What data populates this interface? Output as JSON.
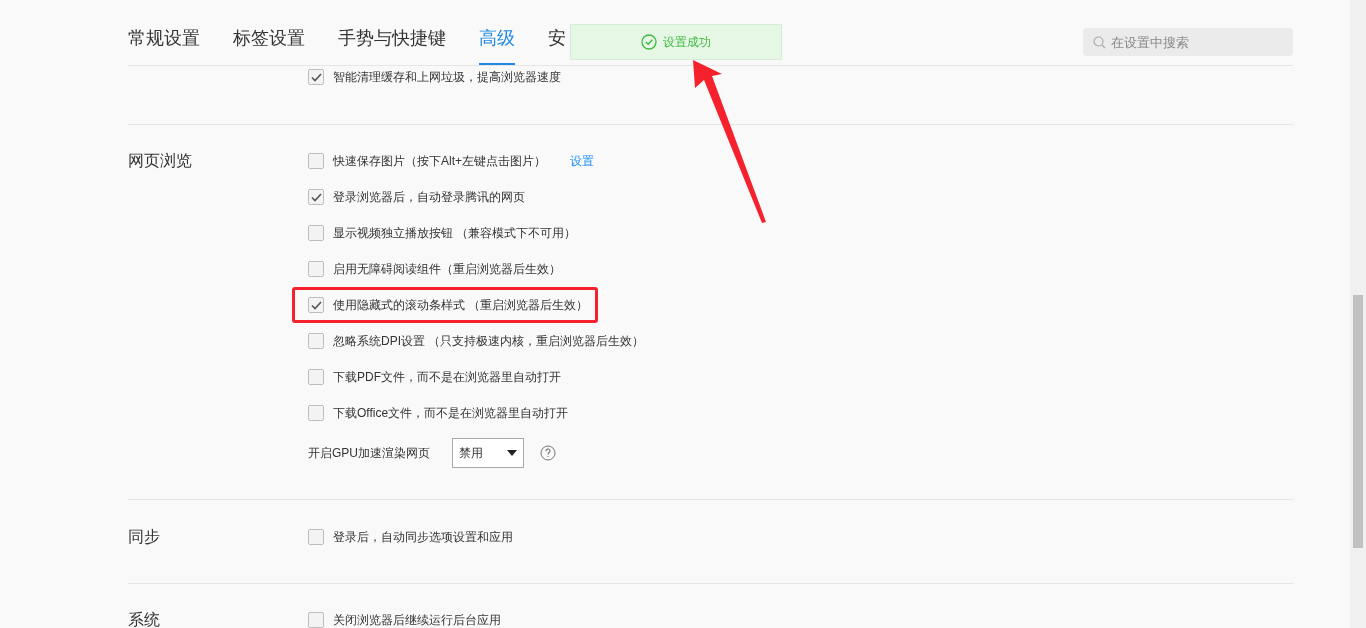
{
  "tabs": [
    {
      "label": "常规设置",
      "selected": false
    },
    {
      "label": "标签设置",
      "selected": false
    },
    {
      "label": "手势与快捷键",
      "selected": false
    },
    {
      "label": "高级",
      "selected": true
    },
    {
      "label": "安",
      "selected": false
    }
  ],
  "toast": {
    "text": "设置成功"
  },
  "search": {
    "placeholder": "在设置中搜索"
  },
  "sections": [
    {
      "options": [
        {
          "kind": "checkbox",
          "label": "智能清理缓存和上网垃圾，提高浏览器速度",
          "checked": true,
          "highlighted": false
        }
      ]
    },
    {
      "title": "网页浏览",
      "options": [
        {
          "kind": "checkbox",
          "label": "快速保存图片（按下Alt+左键点击图片）",
          "checked": false,
          "highlighted": false,
          "link": "设置"
        },
        {
          "kind": "checkbox",
          "label": "登录浏览器后，自动登录腾讯的网页",
          "checked": true,
          "highlighted": false
        },
        {
          "kind": "checkbox",
          "label": "显示视频独立播放按钮 （兼容模式下不可用）",
          "checked": false,
          "highlighted": false
        },
        {
          "kind": "checkbox",
          "label": "启用无障碍阅读组件（重启浏览器后生效）",
          "checked": false,
          "highlighted": false
        },
        {
          "kind": "checkbox",
          "label": "使用隐藏式的滚动条样式 （重启浏览器后生效）",
          "checked": true,
          "highlighted": true
        },
        {
          "kind": "checkbox",
          "label": "忽略系统DPI设置 （只支持极速内核，重启浏览器后生效）",
          "checked": false,
          "highlighted": false
        },
        {
          "kind": "checkbox",
          "label": "下载PDF文件，而不是在浏览器里自动打开",
          "checked": false,
          "highlighted": false
        },
        {
          "kind": "checkbox",
          "label": "下载Office文件，而不是在浏览器里自动打开",
          "checked": false,
          "highlighted": false
        },
        {
          "kind": "select",
          "label": "开启GPU加速渲染网页",
          "value": "禁用"
        }
      ]
    },
    {
      "title": "同步",
      "options": [
        {
          "kind": "checkbox",
          "label": "登录后，自动同步选项设置和应用",
          "checked": false,
          "highlighted": false
        }
      ]
    },
    {
      "title": "系统",
      "options": [
        {
          "kind": "checkbox",
          "label": "关闭浏览器后继续运行后台应用",
          "checked": false,
          "highlighted": false
        }
      ]
    }
  ]
}
